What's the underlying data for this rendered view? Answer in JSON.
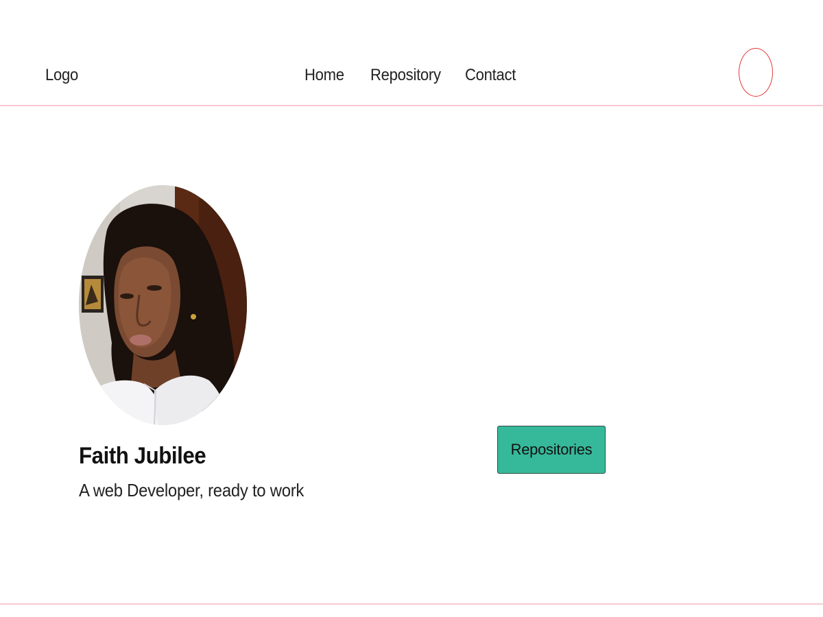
{
  "header": {
    "logo": "Logo",
    "nav": {
      "home": "Home",
      "repository": "Repository",
      "contact": "Contact"
    },
    "avatar_border_color": "#e53935"
  },
  "profile": {
    "name": "Faith Jubilee",
    "tagline": "A web Developer, ready to work"
  },
  "actions": {
    "repositories_label": "Repositories",
    "button_color": "#36b99a"
  },
  "colors": {
    "divider": "#f7c8d3"
  }
}
